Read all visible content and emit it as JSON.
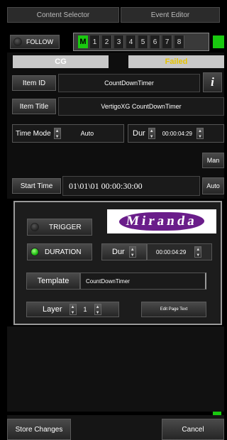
{
  "tabs": [
    {
      "label": "Content Selector"
    },
    {
      "label": "Event Editor"
    }
  ],
  "follow": {
    "label": "FOLLOW"
  },
  "channel_buttons": [
    "M",
    "1",
    "2",
    "3",
    "4",
    "5",
    "6",
    "7",
    "8"
  ],
  "status": {
    "cg_label": "CG",
    "failed_label": "Failed",
    "failed_color": "#e6c300"
  },
  "item_id": {
    "label": "Item ID",
    "value": "CountDownTimer",
    "info_glyph": "i"
  },
  "item_title": {
    "label": "Item Title",
    "value": "VertigoXG CountDownTimer"
  },
  "time_mode": {
    "label": "Time Mode",
    "value": "Auto"
  },
  "duration_top": {
    "label": "Dur",
    "value": "00:00:04:29"
  },
  "man_button": {
    "label": "Man"
  },
  "start_time": {
    "label": "Start Time",
    "value": "01\\01\\01 00:00:30:00",
    "mode": "Auto"
  },
  "plugin": {
    "trigger_label": "TRIGGER",
    "logo_text": "Miranda",
    "duration_label": "DURATION",
    "dur_label": "Dur",
    "dur_value": "00:00:04:29",
    "template_label": "Template",
    "template_value": "CountDownTimer",
    "layer_label": "Layer",
    "layer_value": "1",
    "edit_page_text": "Edit Page Text"
  },
  "footer": {
    "store_label": "Store Changes",
    "cancel_label": "Cancel"
  },
  "colors": {
    "accent_green": "#19c90f",
    "logo_purple": "#6a1d8a"
  }
}
